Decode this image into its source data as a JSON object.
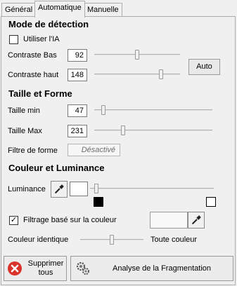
{
  "tabs": [
    "Général",
    "Automatique",
    "Manuelle"
  ],
  "detection": {
    "title": "Mode de détection",
    "use_ai_label": "Utiliser l'IA",
    "use_ai_checked": false,
    "contrast_low_label": "Contraste Bas",
    "contrast_low_value": "92",
    "contrast_high_label": "Contraste haut",
    "contrast_high_value": "148",
    "auto_button": "Auto"
  },
  "size_shape": {
    "title": "Taille et Forme",
    "min_label": "Taille min",
    "min_value": "47",
    "max_label": "Taille Max",
    "max_value": "231",
    "shape_filter_label": "Filtre de forme",
    "shape_filter_value": "Désactivé"
  },
  "color_luminance": {
    "title": "Couleur et Luminance",
    "luminance_label": "Luminance",
    "color_filter_label": "Filtrage basé sur la couleur",
    "color_filter_checked": true,
    "identical_label": "Couleur identique",
    "all_colors_label": "Toute couleur"
  },
  "actions": {
    "delete_label_1": "Supprimer",
    "delete_label_2": "tous",
    "analyze_label": "Analyse de la Fragmentation"
  },
  "colors": {
    "delete_icon": "#d9342b",
    "swatch_black": "#000000",
    "swatch_white": "#ffffff"
  },
  "icons": {
    "delete": "close-icon",
    "analyze": "gears-icon",
    "eyedropper": "eyedropper-icon"
  }
}
